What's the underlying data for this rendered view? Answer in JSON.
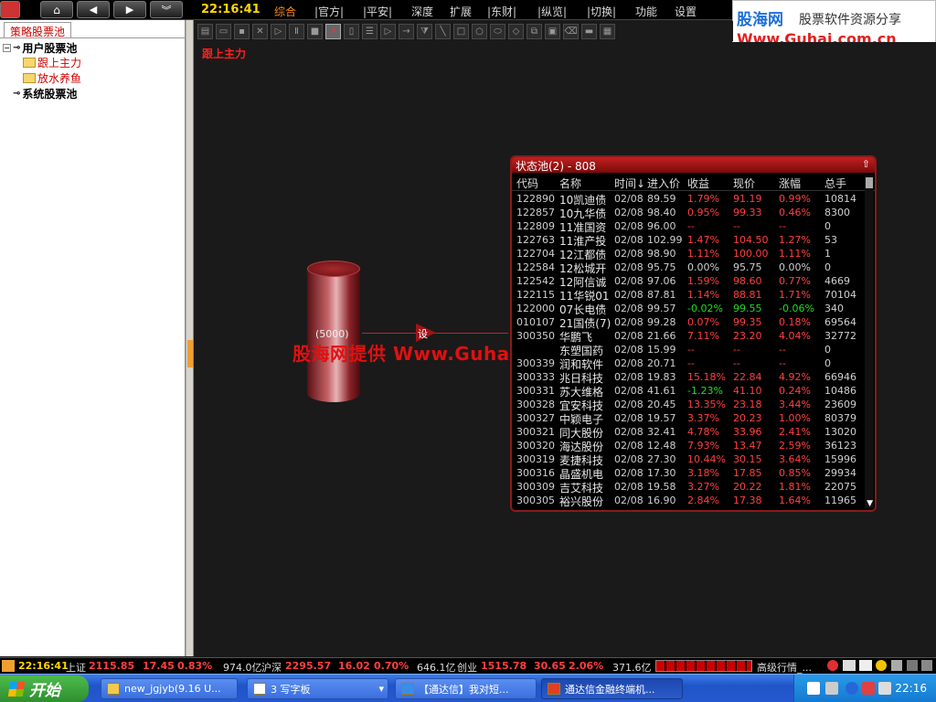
{
  "topbar": {
    "time": "22:16:41",
    "menus": [
      "综合",
      "|官方|",
      "|平安|",
      "深度",
      "扩展",
      "|东财|",
      "|纵览|",
      "|切换|",
      "功能",
      "设置"
    ],
    "active_menu": "综合",
    "logo_main": "股海网",
    "logo_sub": "股票软件资源分享",
    "logo_url": "Www.Guhai.com.cn"
  },
  "left_panel": {
    "tab": "策略股票池",
    "user_pool": "用户股票池",
    "user_items": [
      "跟上主力",
      "放水养鱼"
    ],
    "system_pool": "系统股票池"
  },
  "canvas": {
    "title": "跟上主力",
    "cylinder_label": "(5000)",
    "node_label": "设",
    "watermark": "股海网提供 Www.Guhai.com.CN"
  },
  "pool": {
    "title": "状态池(2) - 808",
    "columns": [
      "代码",
      "名称",
      "时间↓",
      "进入价",
      "收益",
      "现价",
      "涨幅",
      "总手"
    ],
    "rows": [
      {
        "code": "122890",
        "name": "10凯迪债",
        "time": "02/08",
        "in": "89.59",
        "pl": "1.79%",
        "now": "91.19",
        "ch": "0.99%",
        "vol": "10814",
        "dir": "up"
      },
      {
        "code": "122857",
        "name": "10九华债",
        "time": "02/08",
        "in": "98.40",
        "pl": "0.95%",
        "now": "99.33",
        "ch": "0.46%",
        "vol": "8300",
        "dir": "up"
      },
      {
        "code": "122809",
        "name": "11准国资",
        "time": "02/08",
        "in": "96.00",
        "pl": "--",
        "now": "--",
        "ch": "--",
        "vol": "0",
        "dir": "up"
      },
      {
        "code": "122763",
        "name": "11淮产投",
        "time": "02/08",
        "in": "102.99",
        "pl": "1.47%",
        "now": "104.50",
        "ch": "1.27%",
        "vol": "53",
        "dir": "up"
      },
      {
        "code": "122704",
        "name": "12江都债",
        "time": "02/08",
        "in": "98.90",
        "pl": "1.11%",
        "now": "100.00",
        "ch": "1.11%",
        "vol": "1",
        "dir": "up"
      },
      {
        "code": "122584",
        "name": "12松城开",
        "time": "02/08",
        "in": "95.75",
        "pl": "0.00%",
        "now": "95.75",
        "ch": "0.00%",
        "vol": "0",
        "dir": "eq"
      },
      {
        "code": "122542",
        "name": "12阿信诚",
        "time": "02/08",
        "in": "97.06",
        "pl": "1.59%",
        "now": "98.60",
        "ch": "0.77%",
        "vol": "4669",
        "dir": "up"
      },
      {
        "code": "122115",
        "name": "11华锐01",
        "time": "02/08",
        "in": "87.81",
        "pl": "1.14%",
        "now": "88.81",
        "ch": "1.71%",
        "vol": "70104",
        "dir": "up"
      },
      {
        "code": "122000",
        "name": "07长电债",
        "time": "02/08",
        "in": "99.57",
        "pl": "-0.02%",
        "now": "99.55",
        "ch": "-0.06%",
        "vol": "340",
        "dir": "dn"
      },
      {
        "code": "010107",
        "name": "21国债(7)",
        "time": "02/08",
        "in": "99.28",
        "pl": "0.07%",
        "now": "99.35",
        "ch": "0.18%",
        "vol": "69564",
        "dir": "up"
      },
      {
        "code": "300350",
        "name": "华鹏飞",
        "time": "02/08",
        "in": "21.66",
        "pl": "7.11%",
        "now": "23.20",
        "ch": "4.04%",
        "vol": "32772",
        "dir": "up"
      },
      {
        "code": "",
        "name": "东塑国药",
        "time": "02/08",
        "in": "15.99",
        "pl": "--",
        "now": "--",
        "ch": "--",
        "vol": "0",
        "dir": "up"
      },
      {
        "code": "300339",
        "name": "润和软件",
        "time": "02/08",
        "in": "20.71",
        "pl": "--",
        "now": "--",
        "ch": "--",
        "vol": "0",
        "dir": "up"
      },
      {
        "code": "300333",
        "name": "兆日科技",
        "time": "02/08",
        "in": "19.83",
        "pl": "15.18%",
        "now": "22.84",
        "ch": "4.92%",
        "vol": "66946",
        "dir": "up"
      },
      {
        "code": "300331",
        "name": "苏大维格",
        "time": "02/08",
        "in": "41.61",
        "pl": "-1.23%",
        "now": "41.10",
        "ch": "0.24%",
        "vol": "10486",
        "dir": "mix"
      },
      {
        "code": "300328",
        "name": "宜安科技",
        "time": "02/08",
        "in": "20.45",
        "pl": "13.35%",
        "now": "23.18",
        "ch": "3.44%",
        "vol": "23609",
        "dir": "up"
      },
      {
        "code": "300327",
        "name": "中颖电子",
        "time": "02/08",
        "in": "19.57",
        "pl": "3.37%",
        "now": "20.23",
        "ch": "1.00%",
        "vol": "80379",
        "dir": "up"
      },
      {
        "code": "300321",
        "name": "同大股份",
        "time": "02/08",
        "in": "32.41",
        "pl": "4.78%",
        "now": "33.96",
        "ch": "2.41%",
        "vol": "13020",
        "dir": "up"
      },
      {
        "code": "300320",
        "name": "海达股份",
        "time": "02/08",
        "in": "12.48",
        "pl": "7.93%",
        "now": "13.47",
        "ch": "2.59%",
        "vol": "36123",
        "dir": "up"
      },
      {
        "code": "300319",
        "name": "麦捷科技",
        "time": "02/08",
        "in": "27.30",
        "pl": "10.44%",
        "now": "30.15",
        "ch": "3.64%",
        "vol": "15996",
        "dir": "up"
      },
      {
        "code": "300316",
        "name": "晶盛机电",
        "time": "02/08",
        "in": "17.30",
        "pl": "3.18%",
        "now": "17.85",
        "ch": "0.85%",
        "vol": "29934",
        "dir": "up"
      },
      {
        "code": "300309",
        "name": "吉艾科技",
        "time": "02/08",
        "in": "19.58",
        "pl": "3.27%",
        "now": "20.22",
        "ch": "1.81%",
        "vol": "22075",
        "dir": "up"
      },
      {
        "code": "300305",
        "name": "裕兴股份",
        "time": "02/08",
        "in": "16.90",
        "pl": "2.84%",
        "now": "17.38",
        "ch": "1.64%",
        "vol": "11965",
        "dir": "up"
      }
    ]
  },
  "statusbar": {
    "time": "22:16:41",
    "sh_label": "上证",
    "sh_index": "2115.85",
    "sh_change": "17.45",
    "sh_pct": "0.83%",
    "sh_amount": "974.0亿",
    "sz_label": "沪深",
    "sz_index": "2295.57",
    "sz_change": "16.02",
    "sz_pct": "0.70%",
    "sz_amount": "646.1亿",
    "cy_label": "创业",
    "cy_index": "1515.78",
    "cy_change": "30.65",
    "cy_pct": "2.06%",
    "cy_amount": "371.6亿",
    "feed": "高级行情_..."
  },
  "taskbar": {
    "start": "开始",
    "tasks": [
      "new_jgjyb(9.16 U...",
      "3 写字板",
      "【通达信】我对短...",
      "通达信金融终端机..."
    ],
    "clock": "22:16"
  }
}
